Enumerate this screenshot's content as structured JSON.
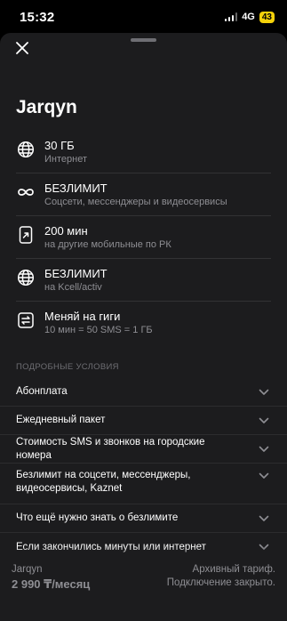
{
  "status_bar": {
    "time": "15:32",
    "network": "4G",
    "battery": "43"
  },
  "sheet": {
    "title": "Jarqyn",
    "features": [
      {
        "icon": "globe-icon",
        "title": "30 ГБ",
        "subtitle": "Интернет"
      },
      {
        "icon": "infinity-icon",
        "title": "БЕЗЛИМИТ",
        "subtitle": "Соцсети, мессенджеры и видеосервисы"
      },
      {
        "icon": "phone-outgoing-icon",
        "title": "200 мин",
        "subtitle": "на другие мобильные по РК"
      },
      {
        "icon": "globe-icon",
        "title": "БЕЗЛИМИТ",
        "subtitle": "на Kcell/activ"
      },
      {
        "icon": "swap-icon",
        "title": "Меняй на гиги",
        "subtitle": "10 мин = 50 SMS = 1 ГБ"
      }
    ],
    "section_label": "ПОДРОБНЫЕ УСЛОВИЯ",
    "conditions": [
      "Абонплата",
      "Ежедневный пакет",
      "Стоимость SMS и звонков на городские номера",
      "Безлимит на соцсети, мессенджеры, видеосервисы, Kaznet",
      "Что ещё нужно знать о безлимите",
      "Если закончились минуты или интернет"
    ]
  },
  "footer": {
    "tariff_name": "Jarqyn",
    "price": "2 990 ₸/месяц",
    "note_line1": "Архивный тариф.",
    "note_line2": "Подключение закрыто."
  },
  "colors": {
    "background": "#000000",
    "sheet": "#1c1c1e",
    "secondary_text": "#8e8e93",
    "battery": "#f5d20a"
  }
}
